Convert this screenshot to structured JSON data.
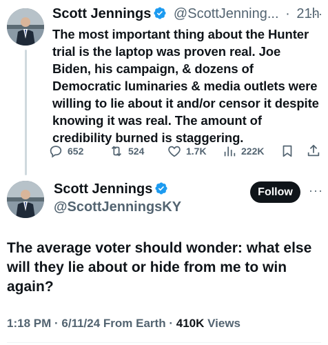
{
  "tweet1": {
    "name": "Scott Jennings",
    "handle": "@ScottJenning...",
    "separator": "·",
    "time": "21h",
    "more": "···",
    "text": "The most important thing about the Hunter trial is the laptop was proven real. Joe Biden, his campaign, & dozens of Democratic luminaries & media outlets were willing to lie about it and/or censor it despite knowing it was real. The amount of credibility burned is staggering.",
    "actions": {
      "replies": "652",
      "reposts": "524",
      "likes": "1.7K",
      "views": "222K"
    }
  },
  "tweet2": {
    "name": "Scott Jennings",
    "handle": "@ScottJenningsKY",
    "follow_label": "Follow",
    "more": "···",
    "text": "The average voter should wonder: what else will they lie about or hide from me to win again?",
    "time": "1:18 PM",
    "dot": "·",
    "date": "6/11/24",
    "source": "From Earth",
    "views_count": "410K",
    "views_label": "Views"
  },
  "colors": {
    "verified": "#1d9bf0",
    "text_primary": "#0f1419",
    "text_secondary": "#536471",
    "follow_bg": "#0f1419"
  },
  "icons": [
    "reply-icon",
    "repost-icon",
    "like-icon",
    "views-icon",
    "bookmark-icon",
    "share-icon",
    "verified-badge-icon"
  ]
}
